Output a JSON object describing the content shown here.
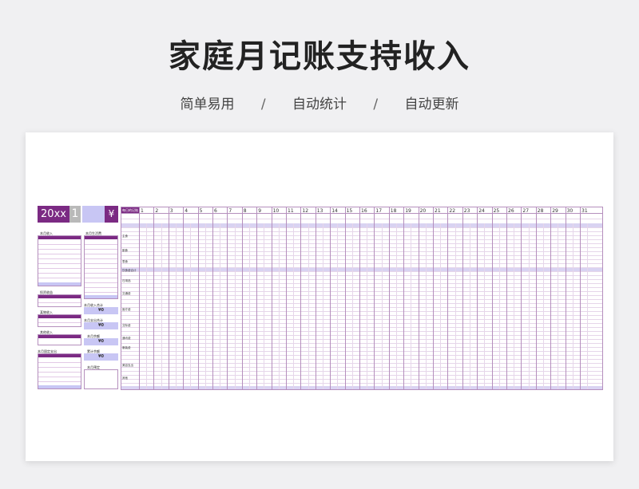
{
  "page": {
    "title": "家庭月记账支持收入",
    "features": [
      "简单易用",
      "自动统计",
      "自动更新"
    ],
    "separator": "/"
  },
  "sheet": {
    "year": "20xx",
    "month": "1",
    "currency": "¥",
    "accent_color": "#7b2a83",
    "highlight_color": "#c8c6f4",
    "sections": {
      "monthly_income": "本月收入",
      "monthly_living_expense": "本月生活费",
      "investment_income": "投资收益",
      "other_income": "某物收入",
      "other_income_2": "其他收入",
      "monthly_fixed_expense": "本月固定支出",
      "monthly_income_total": "本月收入合计",
      "monthly_expense_total": "本月支出合计",
      "monthly_balance": "本月余额",
      "cumulative_balance": "累计余额",
      "monthly_budget": "本月预定"
    },
    "totals": {
      "income_total": "¥0",
      "expense_total": "¥0",
      "balance": "¥0",
      "cumulative": "¥0"
    },
    "daily_header": "每日的记账",
    "day_numbers": [
      "1",
      "2",
      "3",
      "4",
      "5",
      "6",
      "7",
      "8",
      "9",
      "10",
      "11",
      "12",
      "13",
      "14",
      "15",
      "16",
      "17",
      "18",
      "19",
      "20",
      "21",
      "22",
      "23",
      "24",
      "25",
      "26",
      "27",
      "28",
      "29",
      "30",
      "31"
    ],
    "daily_categories": [
      "主食",
      "副食",
      "零食",
      "饮食费合计",
      "日用品",
      "交通费",
      "医疗费",
      "交际费",
      "通讯费",
      "服装费",
      "美容支出",
      "其他"
    ],
    "zero_value": "¥0"
  }
}
